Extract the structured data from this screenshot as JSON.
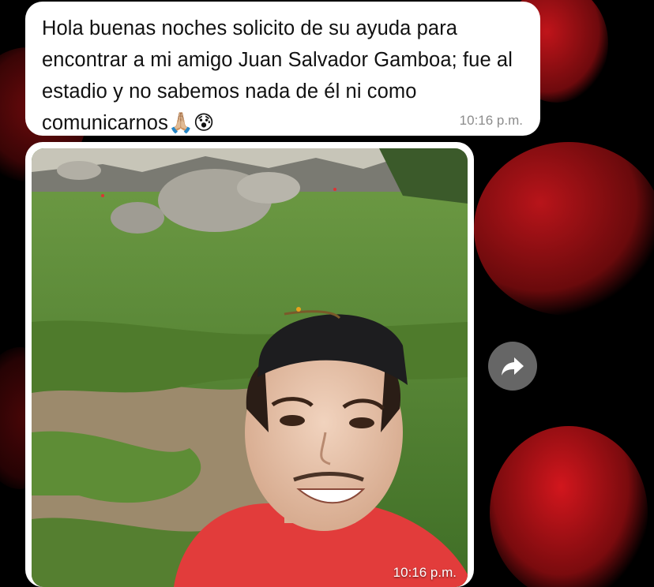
{
  "message": {
    "text": "Hola buenas noches solicito de su ayuda para encontrar a mi amigo Juan Salvador Gamboa; fue al estadio y no sabemos nada de él ni como comunicarnos🙏🏼😰",
    "time": "10:16 p.m."
  },
  "photo_message": {
    "time": "10:16 p.m."
  },
  "icons": {
    "forward": "forward-arrow-icon"
  },
  "colors": {
    "bubble": "#ffffff",
    "timestamp": "#8c8c8c",
    "wallpaper_accent": "#c0141a"
  }
}
